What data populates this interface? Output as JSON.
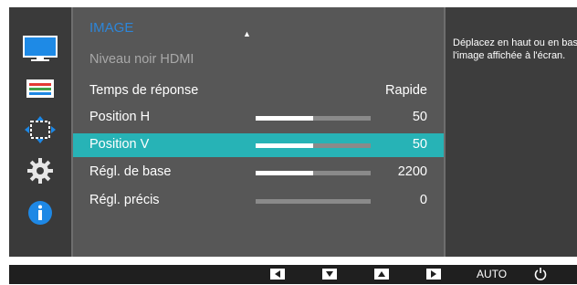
{
  "menu": {
    "title": "IMAGE",
    "items": [
      {
        "label": "Niveau noir HDMI",
        "value": "",
        "dimmed": true
      },
      {
        "label": "Temps de réponse",
        "value": "Rapide"
      },
      {
        "label": "Position H",
        "value": "50",
        "bar_fraction": 0.5
      },
      {
        "label": "Position V",
        "value": "50",
        "bar_fraction": 0.5,
        "selected": true
      },
      {
        "label": "Régl. de base",
        "value": "2200",
        "bar_fraction": 0.5
      },
      {
        "label": "Régl. précis",
        "value": "0",
        "bar_fraction": 0
      }
    ]
  },
  "sidebar_icons": [
    "monitor-icon",
    "color-icon",
    "size-position-icon",
    "gear-icon",
    "info-icon"
  ],
  "help": {
    "text": "Déplacez en haut ou en bas l'image affichée à l'écran."
  },
  "footer": {
    "buttons": [
      "left-arrow-icon",
      "down-arrow-icon",
      "up-arrow-icon",
      "right-arrow-icon"
    ],
    "auto_label": "AUTO",
    "power_icon": "power-icon"
  },
  "colors": {
    "accent": "#27b3b6",
    "title": "#2d86d9",
    "info": "#1e88e5"
  }
}
